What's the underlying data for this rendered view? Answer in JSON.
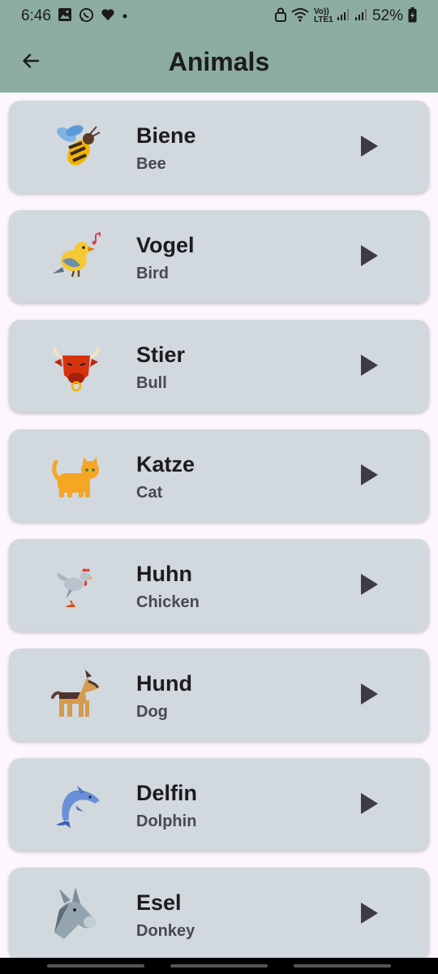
{
  "status_bar": {
    "time": "6:46",
    "network": "Vo)) LTE1",
    "battery": "52%",
    "left_icons": [
      "gallery-icon",
      "whatsapp-icon",
      "heart-icon",
      "dot-icon"
    ],
    "right_icons": [
      "lock-icon",
      "wifi-icon",
      "signal-icon",
      "signal-icon",
      "battery-icon"
    ]
  },
  "app_bar": {
    "title": "Animals",
    "back_icon": "arrow-left-icon",
    "background": "#8cad9f"
  },
  "colors": {
    "card": "#d1d8de",
    "page": "#fdf7fd",
    "play": "#3e3a46"
  },
  "animals": [
    {
      "de": "Biene",
      "en": "Bee",
      "icon": "bee-icon"
    },
    {
      "de": "Vogel",
      "en": "Bird",
      "icon": "bird-icon"
    },
    {
      "de": "Stier",
      "en": "Bull",
      "icon": "bull-icon"
    },
    {
      "de": "Katze",
      "en": "Cat",
      "icon": "cat-icon"
    },
    {
      "de": "Huhn",
      "en": "Chicken",
      "icon": "chicken-icon"
    },
    {
      "de": "Hund",
      "en": "Dog",
      "icon": "dog-icon"
    },
    {
      "de": "Delfin",
      "en": "Dolphin",
      "icon": "dolphin-icon"
    },
    {
      "de": "Esel",
      "en": "Donkey",
      "icon": "donkey-icon"
    }
  ]
}
